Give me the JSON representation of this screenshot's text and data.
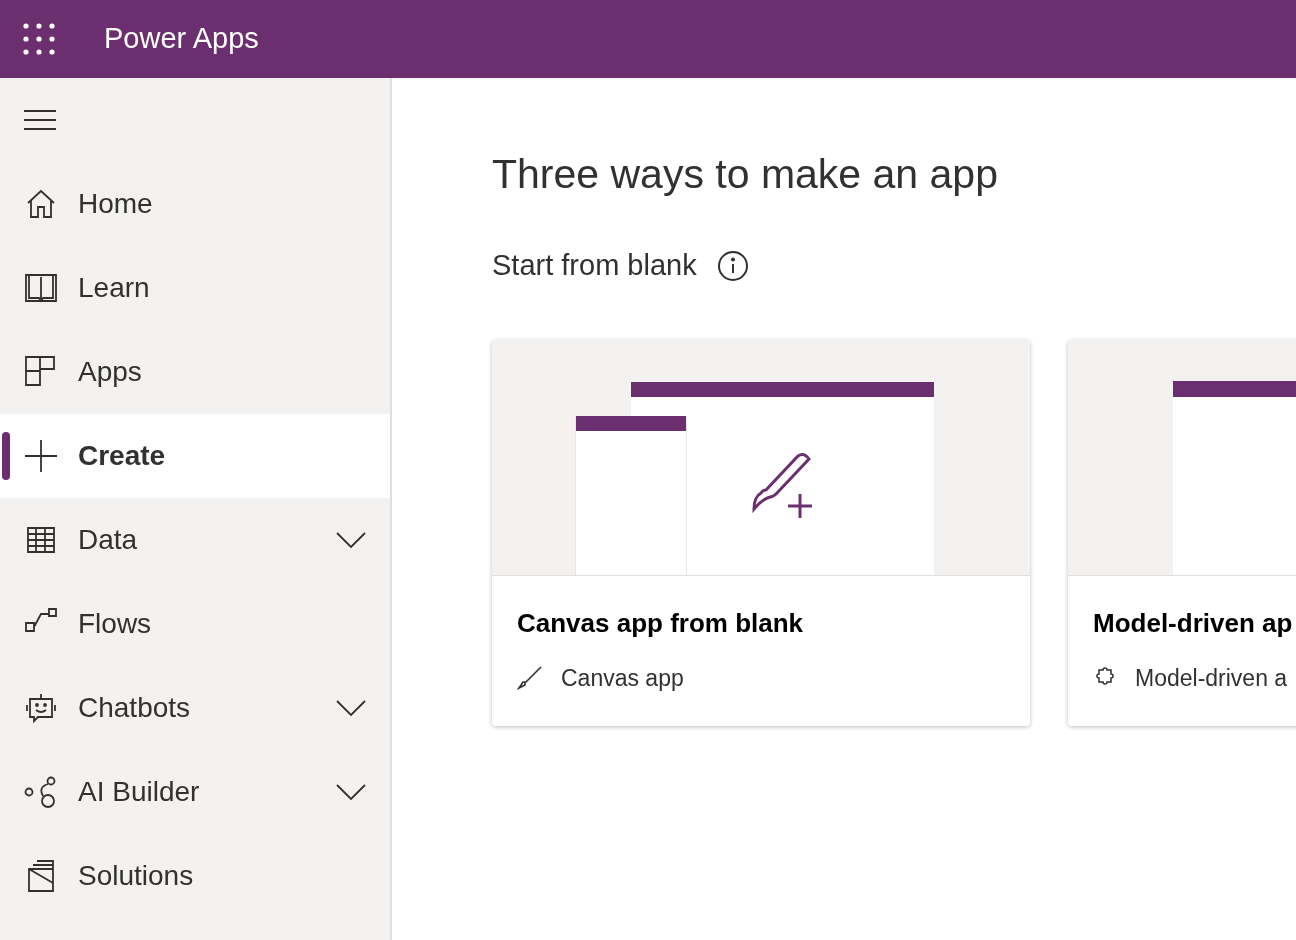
{
  "header": {
    "title": "Power Apps"
  },
  "nav": [
    {
      "label": "Home",
      "expandable": false,
      "selected": false
    },
    {
      "label": "Learn",
      "expandable": false,
      "selected": false
    },
    {
      "label": "Apps",
      "expandable": false,
      "selected": false
    },
    {
      "label": "Create",
      "expandable": false,
      "selected": true
    },
    {
      "label": "Data",
      "expandable": true,
      "selected": false
    },
    {
      "label": "Flows",
      "expandable": false,
      "selected": false
    },
    {
      "label": "Chatbots",
      "expandable": true,
      "selected": false
    },
    {
      "label": "AI Builder",
      "expandable": true,
      "selected": false
    },
    {
      "label": "Solutions",
      "expandable": false,
      "selected": false
    }
  ],
  "main": {
    "title": "Three ways to make an app",
    "section": "Start from blank",
    "cards": [
      {
        "kind": "canvas",
        "title": "Canvas app from blank",
        "subtitle": "Canvas app"
      },
      {
        "kind": "model",
        "title": "Model-driven ap",
        "subtitle": "Model-driven a"
      }
    ]
  }
}
